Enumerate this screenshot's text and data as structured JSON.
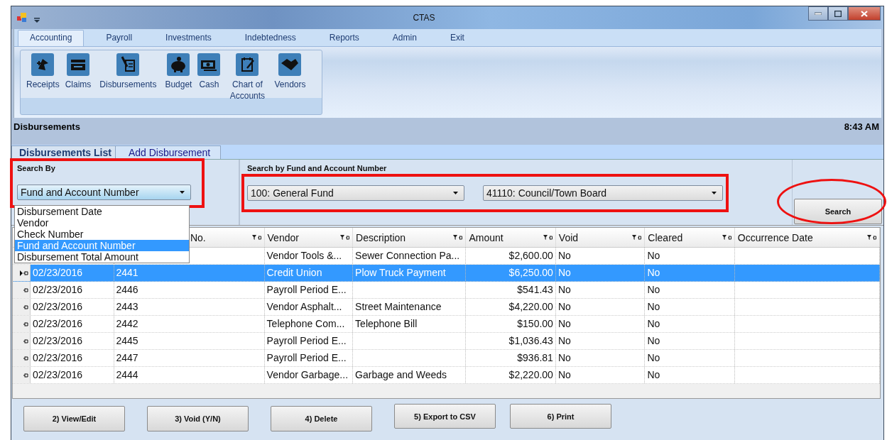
{
  "window": {
    "title": "CTAS"
  },
  "menu_tabs": [
    {
      "label": "Accounting",
      "selected": true
    },
    {
      "label": "Payroll",
      "selected": false
    },
    {
      "label": "Investments",
      "selected": false
    },
    {
      "label": "Indebtedness",
      "selected": false
    },
    {
      "label": "Reports",
      "selected": false
    },
    {
      "label": "Admin",
      "selected": false
    },
    {
      "label": "Exit",
      "selected": false
    }
  ],
  "ribbon": [
    {
      "label": "Receipts",
      "kind": "receipts"
    },
    {
      "label": "Claims",
      "kind": "claims"
    },
    {
      "label": "Disbursements",
      "kind": "disbursements"
    },
    {
      "label": "Budget",
      "kind": "budget"
    },
    {
      "label": "Cash",
      "kind": "cash"
    },
    {
      "label": "Chart of Accounts",
      "kind": "chart"
    },
    {
      "label": "Vendors",
      "kind": "vendors"
    }
  ],
  "header": {
    "title": "Disbursements",
    "time": "8:43 AM"
  },
  "tabs": [
    {
      "label": "Disbursements List",
      "selected": true
    },
    {
      "label": "Add Disbursement",
      "selected": false
    }
  ],
  "search_by": {
    "label": "Search By",
    "value": "Fund and Account Number",
    "boxed": true,
    "expanded": true,
    "options": [
      {
        "label": "Disbursement Date",
        "selected": false
      },
      {
        "label": "Vendor",
        "selected": false
      },
      {
        "label": "Check Number",
        "selected": false
      },
      {
        "label": "Fund and Account Number",
        "selected": true
      },
      {
        "label": "Disbursement Total Amount",
        "selected": false
      }
    ]
  },
  "fund_search": {
    "label": "Search by Fund and Account Number",
    "boxed": true,
    "fund": "100: General Fund",
    "account": "41110: Council/Town Board"
  },
  "search_button": {
    "label": "Search",
    "circled": true
  },
  "table": {
    "columns": [
      "",
      "No.",
      "Vendor",
      "Description",
      "Amount",
      "Void",
      "Cleared",
      "Occurrence Date"
    ],
    "rows": [
      {
        "selected": false,
        "cells": [
          "",
          "",
          "Vendor Tools &...",
          "Sewer Connection Pa...",
          "$2,600.00",
          "No",
          "No",
          ""
        ]
      },
      {
        "selected": true,
        "cells": [
          "02/23/2016",
          "2441",
          "Credit Union",
          "Plow Truck Payment",
          "$6,250.00",
          "No",
          "No",
          ""
        ]
      },
      {
        "selected": false,
        "cells": [
          "02/23/2016",
          "2446",
          "Payroll Period E...",
          "",
          "$541.43",
          "No",
          "No",
          ""
        ]
      },
      {
        "selected": false,
        "cells": [
          "02/23/2016",
          "2443",
          "Vendor Asphalt...",
          "Street Maintenance",
          "$4,220.00",
          "No",
          "No",
          ""
        ]
      },
      {
        "selected": false,
        "cells": [
          "02/23/2016",
          "2442",
          "Telephone Com...",
          "Telephone Bill",
          "$150.00",
          "No",
          "No",
          ""
        ]
      },
      {
        "selected": false,
        "cells": [
          "02/23/2016",
          "2445",
          "Payroll Period E...",
          "",
          "$1,036.43",
          "No",
          "No",
          ""
        ]
      },
      {
        "selected": false,
        "cells": [
          "02/23/2016",
          "2447",
          "Payroll Period E...",
          "",
          "$936.81",
          "No",
          "No",
          ""
        ]
      },
      {
        "selected": false,
        "cells": [
          "02/23/2016",
          "2444",
          "Vendor Garbage...",
          "Garbage and Weeds",
          "$2,220.00",
          "No",
          "No",
          ""
        ]
      }
    ]
  },
  "buttons": [
    "2) View/Edit",
    "3) Void (Y/N)",
    "4) Delete",
    "5) Export to CSV",
    "6) Print"
  ]
}
